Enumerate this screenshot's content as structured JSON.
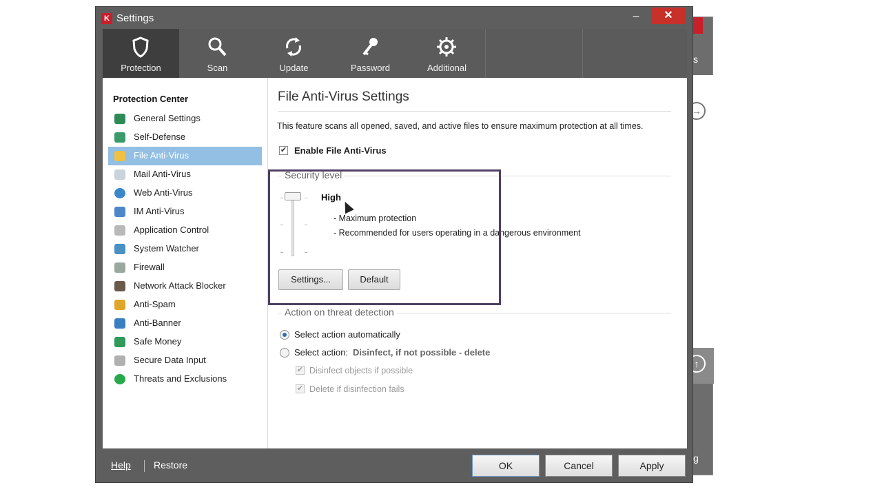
{
  "window": {
    "title": "Settings",
    "minimize": "–",
    "close": "✕"
  },
  "background_window": {
    "edge_text_top": "s",
    "edge_text_bottom": "g"
  },
  "toolbar": {
    "tabs": [
      {
        "label": "Protection",
        "icon": "shield-icon",
        "active": true
      },
      {
        "label": "Scan",
        "icon": "search-icon",
        "active": false
      },
      {
        "label": "Update",
        "icon": "refresh-icon",
        "active": false
      },
      {
        "label": "Password",
        "icon": "key-icon",
        "active": false
      },
      {
        "label": "Additional",
        "icon": "gear-icon",
        "active": false
      }
    ]
  },
  "sidebar": {
    "heading": "Protection Center",
    "items": [
      {
        "label": "General Settings",
        "icon": "shield-green-icon",
        "color": "#2e8b57"
      },
      {
        "label": "Self-Defense",
        "icon": "shield-k-icon",
        "color": "#3a9a6a"
      },
      {
        "label": "File Anti-Virus",
        "icon": "folder-icon",
        "color": "#f0c040",
        "selected": true
      },
      {
        "label": "Mail Anti-Virus",
        "icon": "envelope-icon",
        "color": "#c9d3dc"
      },
      {
        "label": "Web Anti-Virus",
        "icon": "globe-icon",
        "color": "#3b88c9"
      },
      {
        "label": "IM Anti-Virus",
        "icon": "chat-icon",
        "color": "#4d87c7"
      },
      {
        "label": "Application Control",
        "icon": "filter-icon",
        "color": "#b9b9b9"
      },
      {
        "label": "System Watcher",
        "icon": "monitor-icon",
        "color": "#4a90c2"
      },
      {
        "label": "Firewall",
        "icon": "hourglass-icon",
        "color": "#9aa8a0"
      },
      {
        "label": "Network Attack Blocker",
        "icon": "network-icon",
        "color": "#6a5a4a"
      },
      {
        "label": "Anti-Spam",
        "icon": "spam-icon",
        "color": "#e0a62a"
      },
      {
        "label": "Anti-Banner",
        "icon": "banner-icon",
        "color": "#3a7fbf"
      },
      {
        "label": "Safe Money",
        "icon": "money-icon",
        "color": "#2f9a5a"
      },
      {
        "label": "Secure Data Input",
        "icon": "keyboard-icon",
        "color": "#b0b0b0"
      },
      {
        "label": "Threats and Exclusions",
        "icon": "check-circle-icon",
        "color": "#27a84a"
      }
    ]
  },
  "main": {
    "title": "File Anti-Virus Settings",
    "description": "This feature scans all opened, saved, and active files to ensure maximum protection at all times.",
    "enable_label": "Enable File Anti-Virus",
    "enable_checked": true,
    "security_level": {
      "group_label": "Security level",
      "level": "High",
      "details": [
        "- Maximum protection",
        "- Recommended for users operating in a dangerous environment"
      ],
      "settings_button": "Settings...",
      "default_button": "Default"
    },
    "action": {
      "group_label": "Action on threat detection",
      "option_auto": "Select action automatically",
      "option_select": "Select action:",
      "option_select_value": "Disinfect, if not possible - delete",
      "sub_disinfect": "Disinfect objects if possible",
      "sub_delete": "Delete if disinfection fails"
    }
  },
  "footer": {
    "help": "Help",
    "restore": "Restore",
    "ok": "OK",
    "cancel": "Cancel",
    "apply": "Apply"
  },
  "colors": {
    "selection": "#92bfe3",
    "highlight_border": "#4f3f63",
    "window_chrome": "#5e5e5e",
    "close_button": "#c8302a"
  }
}
